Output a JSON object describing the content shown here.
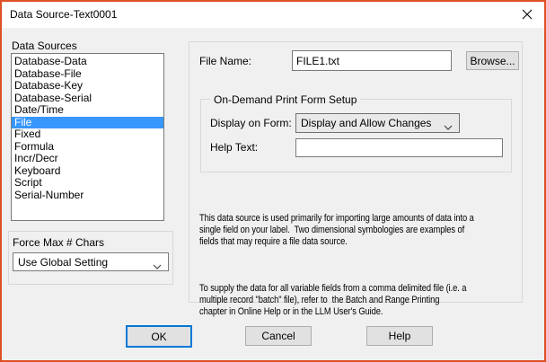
{
  "window": {
    "title": "Data Source-Text0001"
  },
  "data_sources": {
    "label": "Data Sources",
    "items": [
      "Database-Data",
      "Database-File",
      "Database-Key",
      "Database-Serial",
      "Date/Time",
      "File",
      "Fixed",
      "Formula",
      "Incr/Decr",
      "Keyboard",
      "Script",
      "Serial-Number"
    ],
    "selected": "File"
  },
  "file_name": {
    "label": "File Name:",
    "value": "FILE1.txt",
    "browse_label": "Browse..."
  },
  "on_demand": {
    "title": "On-Demand Print Form Setup",
    "display_on_form_label": "Display on Form:",
    "display_on_form_value": "Display and Allow Changes",
    "help_text_label": "Help Text:",
    "help_text_value": ""
  },
  "description": {
    "para1": "This data source is used primarily for importing large amounts of data into a\nsingle field on your label.  Two dimensional symbologies are examples of\nfields that may require a file data source.",
    "para2": "To supply the data for all variable fields from a comma delimited file (i.e. a\nmultiple record \"batch\" file), refer to  the Batch and Range Printing\nchapter in Online Help or in the LLM User's Guide."
  },
  "force_max": {
    "label": "Force Max # Chars",
    "value": "Use Global Setting"
  },
  "buttons": {
    "ok": "OK",
    "cancel": "Cancel",
    "help": "Help"
  },
  "colors": {
    "window_border": "#dd5127",
    "dialog_bg": "#f0f0f0",
    "titlebar_bg": "#ffffff",
    "selection_blue": "#3797fd",
    "default_button_border": "#0078d7",
    "control_border": "#7a7a7a",
    "button_bg": "#e1e1e1"
  }
}
